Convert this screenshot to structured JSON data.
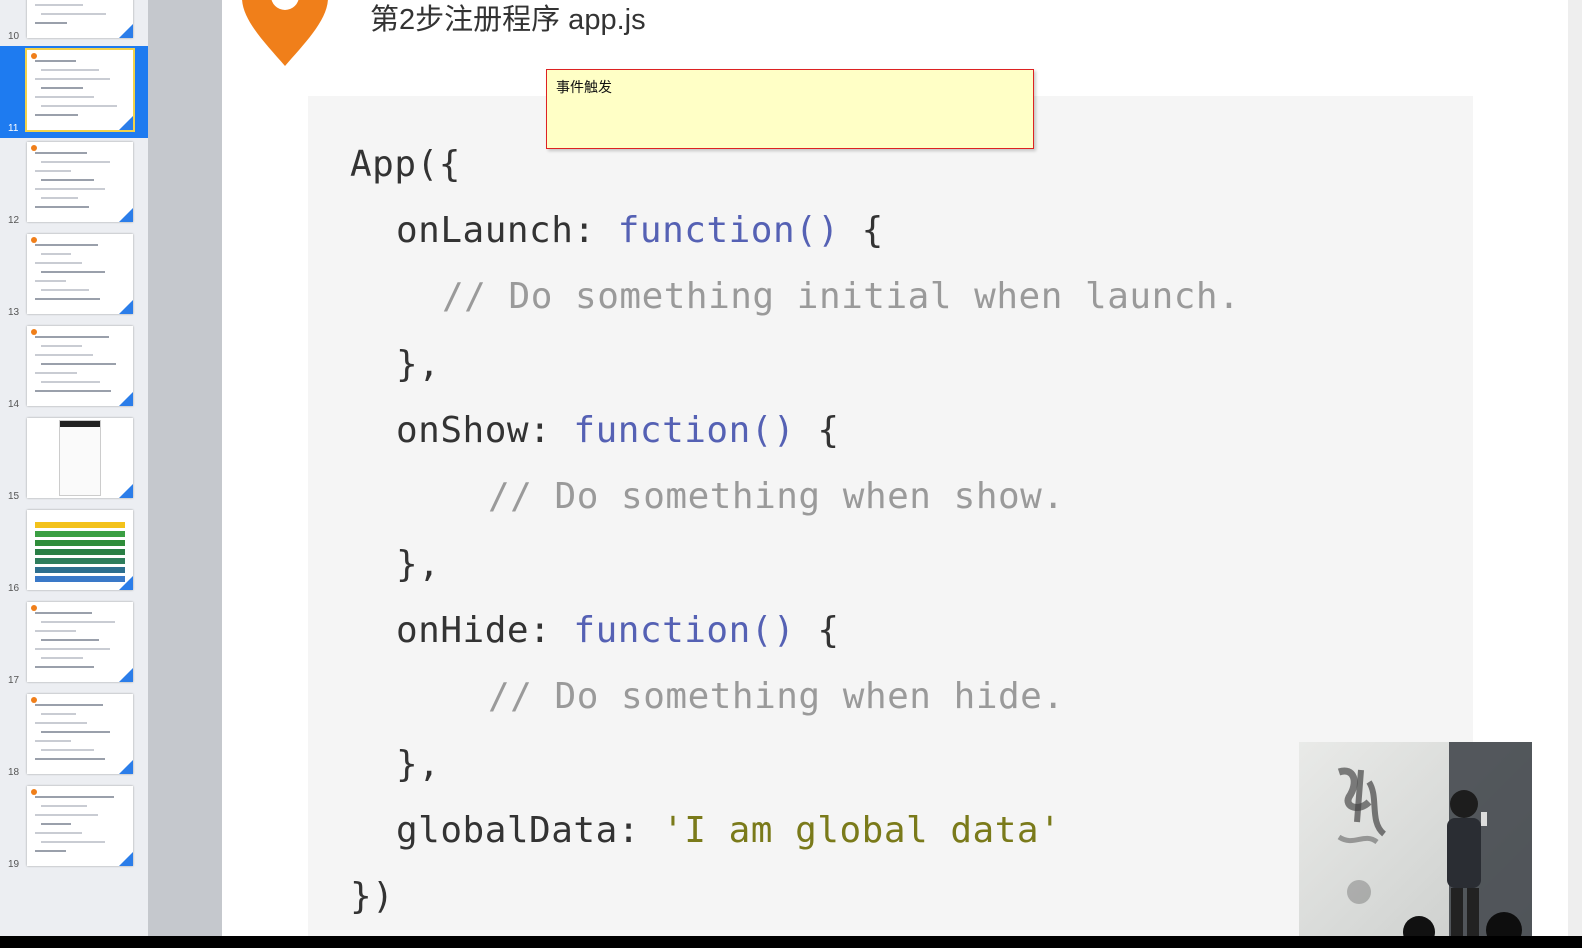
{
  "sidebar": {
    "slides": [
      {
        "number": "10",
        "selected": false
      },
      {
        "number": "11",
        "selected": true
      },
      {
        "number": "12",
        "selected": false
      },
      {
        "number": "13",
        "selected": false
      },
      {
        "number": "14",
        "selected": false
      },
      {
        "number": "15",
        "selected": false
      },
      {
        "number": "16",
        "selected": false
      },
      {
        "number": "17",
        "selected": false
      },
      {
        "number": "18",
        "selected": false
      },
      {
        "number": "19",
        "selected": false
      }
    ]
  },
  "slide": {
    "title": "第2步注册程序 app.js",
    "pin_icon": "location-pin-icon",
    "accent_color": "#f07f1a",
    "note": {
      "text": "事件触发"
    },
    "code": [
      {
        "indent": 0,
        "parts": [
          {
            "t": "App({",
            "c": "plain"
          }
        ]
      },
      {
        "indent": 1,
        "parts": [
          {
            "t": "onLaunch: ",
            "c": "plain"
          },
          {
            "t": "function()",
            "c": "kw"
          },
          {
            "t": " {",
            "c": "plain"
          }
        ]
      },
      {
        "indent": 2,
        "parts": [
          {
            "t": "// Do something initial when launch.",
            "c": "cm"
          }
        ]
      },
      {
        "indent": 1,
        "parts": [
          {
            "t": "},",
            "c": "plain"
          }
        ]
      },
      {
        "indent": 1,
        "parts": [
          {
            "t": "onShow: ",
            "c": "plain"
          },
          {
            "t": "function()",
            "c": "kw"
          },
          {
            "t": " {",
            "c": "plain"
          }
        ]
      },
      {
        "indent": 3,
        "parts": [
          {
            "t": "// Do something when show.",
            "c": "cm"
          }
        ]
      },
      {
        "indent": 1,
        "parts": [
          {
            "t": "},",
            "c": "plain"
          }
        ]
      },
      {
        "indent": 1,
        "parts": [
          {
            "t": "onHide: ",
            "c": "plain"
          },
          {
            "t": "function()",
            "c": "kw"
          },
          {
            "t": " {",
            "c": "plain"
          }
        ]
      },
      {
        "indent": 3,
        "parts": [
          {
            "t": "// Do something when hide.",
            "c": "cm"
          }
        ]
      },
      {
        "indent": 1,
        "parts": [
          {
            "t": "},",
            "c": "plain"
          }
        ]
      },
      {
        "indent": 1,
        "parts": [
          {
            "t": "globalData: ",
            "c": "plain"
          },
          {
            "t": "'I am global data'",
            "c": "str"
          }
        ]
      },
      {
        "indent": 0,
        "parts": [
          {
            "t": "})",
            "c": "plain"
          }
        ]
      }
    ]
  },
  "video": {
    "icon": "presenter-video-feed"
  }
}
